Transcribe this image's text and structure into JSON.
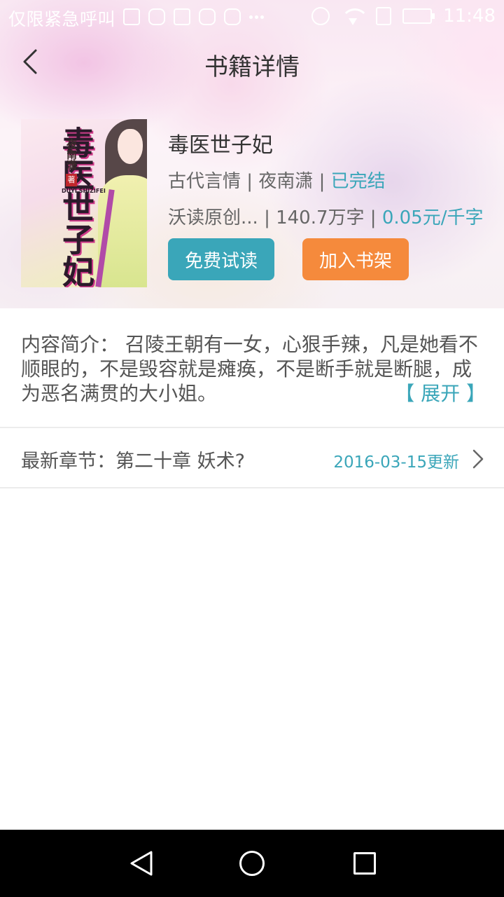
{
  "status_bar": {
    "carrier": "仅限紧急呼叫",
    "time": "11:48"
  },
  "header": {
    "title": "书籍详情"
  },
  "book": {
    "title": "毒医世子妃",
    "category": "古代言情",
    "author": "夜南潇",
    "status": "已完结",
    "publisher": "沃读原创...",
    "word_count": "140.7万字",
    "price": "0.05元/千字",
    "separator": "|",
    "cover": {
      "title_text": "毒医世子妃",
      "author_text": "夜南潇",
      "seal_text": "著",
      "pinyin_text": "DUYI SHIZIFEI"
    }
  },
  "actions": {
    "free_read": "免费试读",
    "add_shelf": "加入书架"
  },
  "summary": {
    "text": "内容简介： 召陵王朝有一女，心狠手辣，凡是她看不顺眼的，不是毁容就是瘫痪，不是断手就是断腿，成为恶名满贯的大小姐。",
    "expand": "【 展开 】"
  },
  "latest_chapter": {
    "label": "最新章节：第二十章 妖术?",
    "updated": "2016-03-15更新"
  },
  "colors": {
    "accent": "#3aa6b9",
    "orange": "#f58a3c"
  },
  "icons": {
    "back": "back-arrow-icon",
    "chevron": "chevron-right-icon",
    "nav_back": "nav-back-icon",
    "nav_home": "nav-home-icon",
    "nav_recent": "nav-recent-icon"
  }
}
